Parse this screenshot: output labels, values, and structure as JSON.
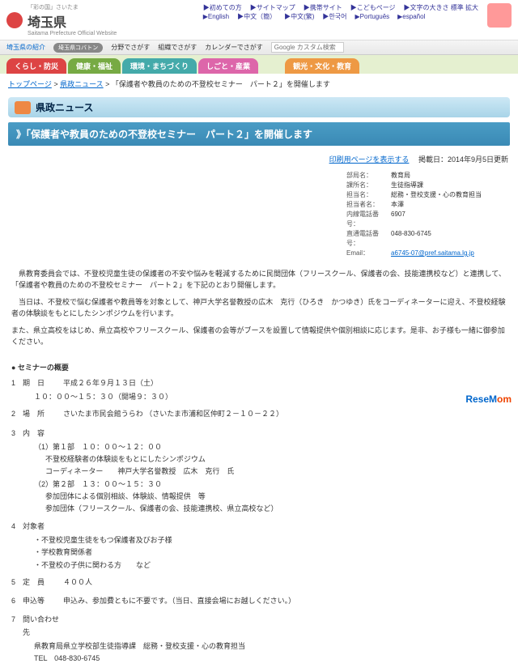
{
  "header": {
    "tagline": "「彩の国」さいたま",
    "pref_name": "埼玉県",
    "pref_sub": "Saitama Prefecture Official Website",
    "intro": "埼玉県の紹介",
    "links_row1": [
      "初めての方",
      "サイトマップ",
      "携帯サイト",
      "こどもページ",
      "文字の大きさ 標準 拡大"
    ],
    "links_row2": [
      "English",
      "中文（簡）",
      "中文(繁)",
      "한국어",
      "Português",
      "español"
    ],
    "mascot": "みどりー川・彩生命さいたま"
  },
  "subheader": {
    "mascot_label": "埼玉県コバトン",
    "search_by_field": "分野でさがす",
    "search_by_org": "組織でさがす",
    "calendar": "カレンダーでさがす",
    "search_placeholder": "Google カスタム検索"
  },
  "nav": [
    "くらし・防災",
    "健康・福祉",
    "環境・まちづくり",
    "しごと・産業",
    "観光・文化・教育"
  ],
  "breadcrumb": {
    "items": [
      "トップページ",
      "県政ニュース"
    ],
    "current": "「保護者や教員のための不登校セミナー　パート２」を開催します"
  },
  "section_header": "県政ニュース",
  "page_title": "》「保護者や教員のための不登校セミナー　パート２」を開催します",
  "meta": {
    "print_link": "印刷用ページを表示する",
    "updated_label": "掲載日：",
    "updated": "2014年9月5日更新"
  },
  "info": {
    "rows": [
      {
        "lbl": "部局名：",
        "val": "教育局"
      },
      {
        "lbl": "課所名：",
        "val": "生徒指導課"
      },
      {
        "lbl": "担当名：",
        "val": "総務・登校支援・心の教育担当"
      },
      {
        "lbl": "担当者名：",
        "val": "本澤"
      },
      {
        "lbl": "内線電話番号：",
        "val": "6907"
      },
      {
        "lbl": "直通電話番号：",
        "val": "048-830-6745"
      }
    ],
    "email_lbl": "Email：",
    "email": "a6745-07@pref.saitama.lg.jp"
  },
  "body": {
    "p1": "　県教育委員会では、不登校児童生徒の保護者の不安や悩みを軽減するために民間団体（フリースクール、保護者の会、技能連携校など）と連携して、「保護者や教員のための不登校セミナー　パート２」を下記のとおり開催します。",
    "p2": "　当日は、不登校で悩む保護者や教員等を対象として、神戸大学名誉教授の広木　克行（ひろき　かつゆき）氏をコーディネーターに迎え、不登校経験者の体験談をもとにしたシンポジウムを行います。",
    "p3": "また、県立高校をはじめ、県立高校やフリースクール、保護者の会等がブースを設置して情報提供や個別相談に応じます。是非、お子様も一緒に御参加ください。"
  },
  "outline": {
    "heading": "● セミナーの概要",
    "items": [
      {
        "num": "1",
        "lbl": "期　日",
        "val": "平成２６年９月１３日（土）"
      },
      {
        "sub": "１０：００～１５：３０（開場９：３０）"
      },
      {
        "spacer": true
      },
      {
        "num": "2",
        "lbl": "場　所",
        "val": "さいたま市民会館うらわ （さいたま市浦和区仲町２－１０－２２）"
      },
      {
        "spacer": true
      },
      {
        "num": "3",
        "lbl": "内　容",
        "val": ""
      },
      {
        "sub": "（1）第１部　１０：００～１２：００"
      },
      {
        "sub2": "不登校経験者の体験談をもとにしたシンポジウム"
      },
      {
        "sub2": "コーディネーター　　神戸大学名誉教授　広木　克行　氏"
      },
      {
        "sub": "（2）第２部　１３：００～１５：３０"
      },
      {
        "sub2": "参加団体による個別相談、体験談、情報提供　等"
      },
      {
        "sub2": "参加団体（フリースクール、保護者の会、技能連携校、県立高校など）"
      },
      {
        "spacer": true
      },
      {
        "num": "4",
        "lbl": "対象者",
        "val": ""
      },
      {
        "sub": "・不登校児童生徒をもつ保護者及びお子様"
      },
      {
        "sub": "・学校教育関係者"
      },
      {
        "sub": "・不登校の子供に関わる方　　など"
      },
      {
        "spacer": true
      },
      {
        "num": "5",
        "lbl": "定　員",
        "val": "４００人"
      },
      {
        "spacer": true
      },
      {
        "num": "6",
        "lbl": "申込等",
        "val": "申込み、参加費ともに不要です。（当日、直接会場にお越しください。）"
      },
      {
        "spacer": true
      },
      {
        "num": "7",
        "lbl": "問い合わせ先",
        "val": ""
      },
      {
        "sub": "県教育局県立学校部生徒指導課　総務・登校支援・心の教育担当"
      },
      {
        "sub": "TEL　048-830-6745"
      }
    ]
  },
  "footer_logo": {
    "r": "ReseM",
    "m": "om"
  }
}
